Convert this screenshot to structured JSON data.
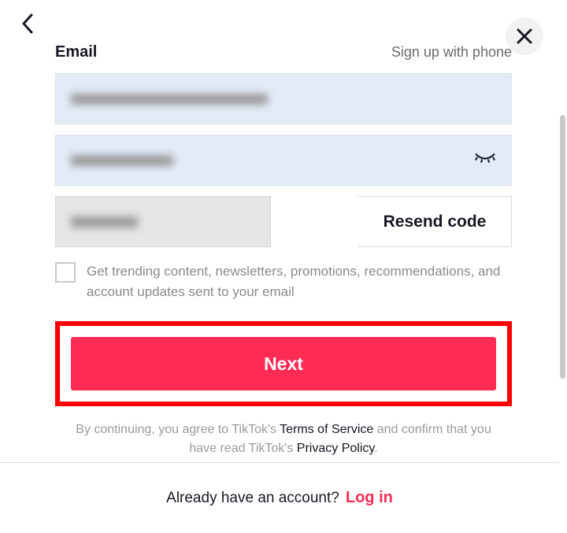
{
  "header": {
    "label": "Email",
    "alt_link": "Sign up with phone"
  },
  "email": {
    "value": "                              "
  },
  "password": {
    "value": "                "
  },
  "code": {
    "value": "          ",
    "resend_label": "Resend code"
  },
  "consent": {
    "text": "Get trending content, newsletters, promotions, recommendations, and account updates sent to your email"
  },
  "next_label": "Next",
  "legal": {
    "prefix": "By continuing, you agree to TikTok's ",
    "tos": "Terms of Service",
    "middle": " and confirm that you have read TikTok's ",
    "pp": "Privacy Policy",
    "suffix": "."
  },
  "footer": {
    "prompt": "Already have an account?",
    "login": "Log in"
  }
}
